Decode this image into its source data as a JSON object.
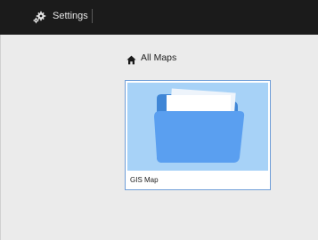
{
  "topbar": {
    "settings_label": "Settings",
    "settings_icon": "settings-gears-icon"
  },
  "breadcrumb": {
    "icon": "home-icon",
    "label": "All Maps"
  },
  "maps": [
    {
      "name": "GIS Map",
      "thumbnail_icon": "folder-icon"
    }
  ],
  "colors": {
    "topbar_bg": "#1b1b1b",
    "page_bg": "#ebebeb",
    "card_border": "#6f9ed8",
    "thumb_bg": "#a7d2f7",
    "folder_blue": "#5a9ff0"
  }
}
